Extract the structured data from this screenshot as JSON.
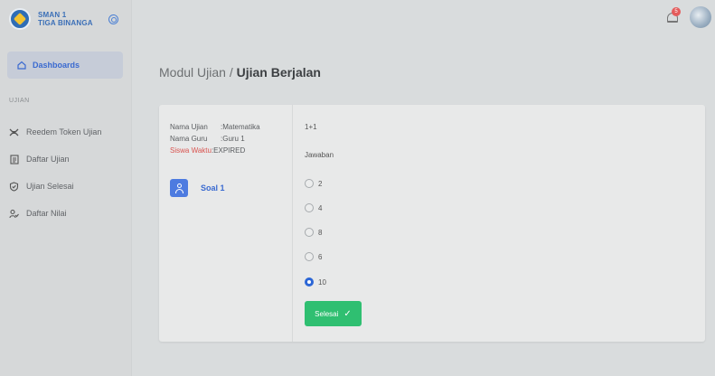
{
  "brand": {
    "line1": "SMAN 1",
    "line2": "TIGA BINANGA"
  },
  "sidebar": {
    "active": {
      "label": "Dashboards",
      "icon": "home-icon"
    },
    "section": "UJIAN",
    "items": [
      {
        "label": "Reedem Token Ujian",
        "icon": "token-icon"
      },
      {
        "label": "Daftar Ujian",
        "icon": "list-icon"
      },
      {
        "label": "Ujian Selesai",
        "icon": "shield-check-icon"
      },
      {
        "label": "Daftar Nilai",
        "icon": "users-icon"
      }
    ]
  },
  "header": {
    "notification_count": "5"
  },
  "breadcrumb": {
    "parent": "Modul Ujian / ",
    "current": "Ujian Berjalan"
  },
  "exam": {
    "name_label": "Nama Ujian",
    "name_value": ":Matematika",
    "teacher_label": "Nama Guru",
    "teacher_value": ":Guru 1",
    "time_label": "Siswa Waktu",
    "time_value": ":EXPIRED",
    "soal_label": "Soal 1"
  },
  "question": {
    "text": "1+1",
    "answer_label": "Jawaban",
    "options": [
      "2",
      "4",
      "8",
      "6",
      "10"
    ],
    "selected": "10",
    "submit_label": "Selesai"
  },
  "colors": {
    "accent": "#3a6ad0",
    "success": "#2fbf71",
    "danger": "#d9534f"
  }
}
